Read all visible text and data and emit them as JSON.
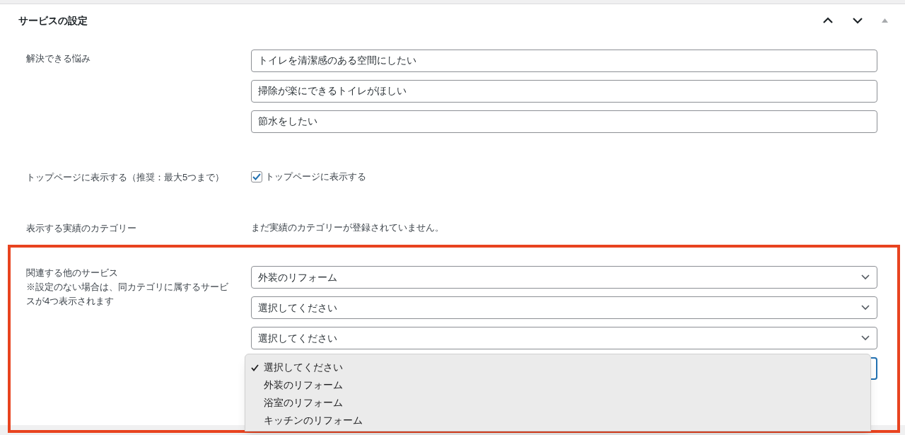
{
  "panel": {
    "title": "サービスの設定"
  },
  "problems": {
    "label": "解決できる悩み",
    "values": [
      "トイレを清潔感のある空間にしたい",
      "掃除が楽にできるトイレがほしい",
      "節水をしたい"
    ]
  },
  "top_page": {
    "label": "トップページに表示する（推奨：最大5つまで）",
    "checkbox_label": "トップページに表示する",
    "checked": true
  },
  "categories": {
    "label": "表示する実績のカテゴリー",
    "message": "まだ実績のカテゴリーが登録されていません。"
  },
  "related": {
    "label": "関連する他のサービス",
    "note": "※設定のない場合は、同カテゴリに属するサービスが4つ表示されます",
    "selects": [
      {
        "value": "外装のリフォーム"
      },
      {
        "value": "選択してください"
      },
      {
        "value": "選択してください"
      }
    ],
    "open_menu": [
      {
        "label": "選択してください",
        "selected": true
      },
      {
        "label": "外装のリフォーム",
        "selected": false
      },
      {
        "label": "浴室のリフォーム",
        "selected": false
      },
      {
        "label": "キッチンのリフォーム",
        "selected": false
      }
    ]
  }
}
